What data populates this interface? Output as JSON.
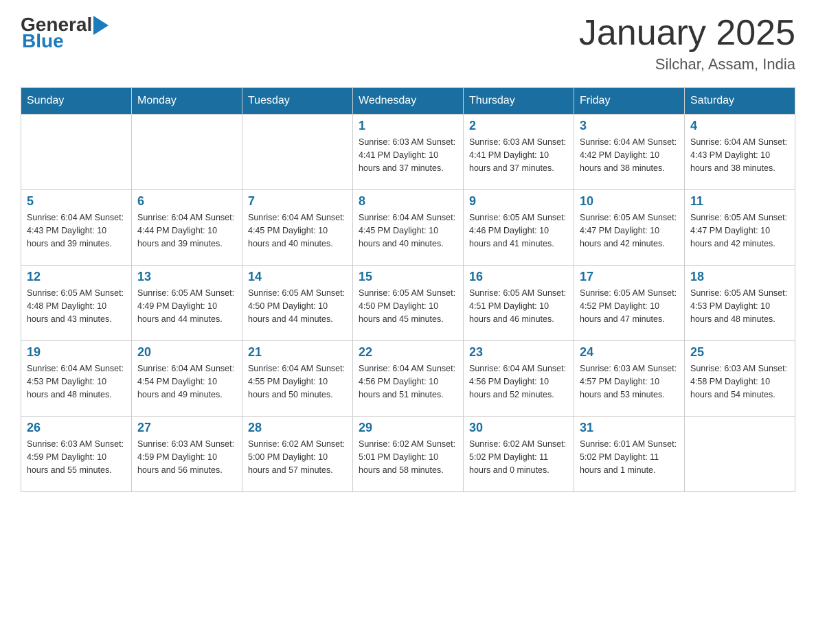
{
  "header": {
    "logo": {
      "general": "General",
      "blue": "Blue",
      "triangle_alt": "triangle logo"
    },
    "title": "January 2025",
    "subtitle": "Silchar, Assam, India"
  },
  "weekdays": [
    "Sunday",
    "Monday",
    "Tuesday",
    "Wednesday",
    "Thursday",
    "Friday",
    "Saturday"
  ],
  "weeks": [
    [
      {
        "day": "",
        "info": ""
      },
      {
        "day": "",
        "info": ""
      },
      {
        "day": "",
        "info": ""
      },
      {
        "day": "1",
        "info": "Sunrise: 6:03 AM\nSunset: 4:41 PM\nDaylight: 10 hours\nand 37 minutes."
      },
      {
        "day": "2",
        "info": "Sunrise: 6:03 AM\nSunset: 4:41 PM\nDaylight: 10 hours\nand 37 minutes."
      },
      {
        "day": "3",
        "info": "Sunrise: 6:04 AM\nSunset: 4:42 PM\nDaylight: 10 hours\nand 38 minutes."
      },
      {
        "day": "4",
        "info": "Sunrise: 6:04 AM\nSunset: 4:43 PM\nDaylight: 10 hours\nand 38 minutes."
      }
    ],
    [
      {
        "day": "5",
        "info": "Sunrise: 6:04 AM\nSunset: 4:43 PM\nDaylight: 10 hours\nand 39 minutes."
      },
      {
        "day": "6",
        "info": "Sunrise: 6:04 AM\nSunset: 4:44 PM\nDaylight: 10 hours\nand 39 minutes."
      },
      {
        "day": "7",
        "info": "Sunrise: 6:04 AM\nSunset: 4:45 PM\nDaylight: 10 hours\nand 40 minutes."
      },
      {
        "day": "8",
        "info": "Sunrise: 6:04 AM\nSunset: 4:45 PM\nDaylight: 10 hours\nand 40 minutes."
      },
      {
        "day": "9",
        "info": "Sunrise: 6:05 AM\nSunset: 4:46 PM\nDaylight: 10 hours\nand 41 minutes."
      },
      {
        "day": "10",
        "info": "Sunrise: 6:05 AM\nSunset: 4:47 PM\nDaylight: 10 hours\nand 42 minutes."
      },
      {
        "day": "11",
        "info": "Sunrise: 6:05 AM\nSunset: 4:47 PM\nDaylight: 10 hours\nand 42 minutes."
      }
    ],
    [
      {
        "day": "12",
        "info": "Sunrise: 6:05 AM\nSunset: 4:48 PM\nDaylight: 10 hours\nand 43 minutes."
      },
      {
        "day": "13",
        "info": "Sunrise: 6:05 AM\nSunset: 4:49 PM\nDaylight: 10 hours\nand 44 minutes."
      },
      {
        "day": "14",
        "info": "Sunrise: 6:05 AM\nSunset: 4:50 PM\nDaylight: 10 hours\nand 44 minutes."
      },
      {
        "day": "15",
        "info": "Sunrise: 6:05 AM\nSunset: 4:50 PM\nDaylight: 10 hours\nand 45 minutes."
      },
      {
        "day": "16",
        "info": "Sunrise: 6:05 AM\nSunset: 4:51 PM\nDaylight: 10 hours\nand 46 minutes."
      },
      {
        "day": "17",
        "info": "Sunrise: 6:05 AM\nSunset: 4:52 PM\nDaylight: 10 hours\nand 47 minutes."
      },
      {
        "day": "18",
        "info": "Sunrise: 6:05 AM\nSunset: 4:53 PM\nDaylight: 10 hours\nand 48 minutes."
      }
    ],
    [
      {
        "day": "19",
        "info": "Sunrise: 6:04 AM\nSunset: 4:53 PM\nDaylight: 10 hours\nand 48 minutes."
      },
      {
        "day": "20",
        "info": "Sunrise: 6:04 AM\nSunset: 4:54 PM\nDaylight: 10 hours\nand 49 minutes."
      },
      {
        "day": "21",
        "info": "Sunrise: 6:04 AM\nSunset: 4:55 PM\nDaylight: 10 hours\nand 50 minutes."
      },
      {
        "day": "22",
        "info": "Sunrise: 6:04 AM\nSunset: 4:56 PM\nDaylight: 10 hours\nand 51 minutes."
      },
      {
        "day": "23",
        "info": "Sunrise: 6:04 AM\nSunset: 4:56 PM\nDaylight: 10 hours\nand 52 minutes."
      },
      {
        "day": "24",
        "info": "Sunrise: 6:03 AM\nSunset: 4:57 PM\nDaylight: 10 hours\nand 53 minutes."
      },
      {
        "day": "25",
        "info": "Sunrise: 6:03 AM\nSunset: 4:58 PM\nDaylight: 10 hours\nand 54 minutes."
      }
    ],
    [
      {
        "day": "26",
        "info": "Sunrise: 6:03 AM\nSunset: 4:59 PM\nDaylight: 10 hours\nand 55 minutes."
      },
      {
        "day": "27",
        "info": "Sunrise: 6:03 AM\nSunset: 4:59 PM\nDaylight: 10 hours\nand 56 minutes."
      },
      {
        "day": "28",
        "info": "Sunrise: 6:02 AM\nSunset: 5:00 PM\nDaylight: 10 hours\nand 57 minutes."
      },
      {
        "day": "29",
        "info": "Sunrise: 6:02 AM\nSunset: 5:01 PM\nDaylight: 10 hours\nand 58 minutes."
      },
      {
        "day": "30",
        "info": "Sunrise: 6:02 AM\nSunset: 5:02 PM\nDaylight: 11 hours\nand 0 minutes."
      },
      {
        "day": "31",
        "info": "Sunrise: 6:01 AM\nSunset: 5:02 PM\nDaylight: 11 hours\nand 1 minute."
      },
      {
        "day": "",
        "info": ""
      }
    ]
  ]
}
